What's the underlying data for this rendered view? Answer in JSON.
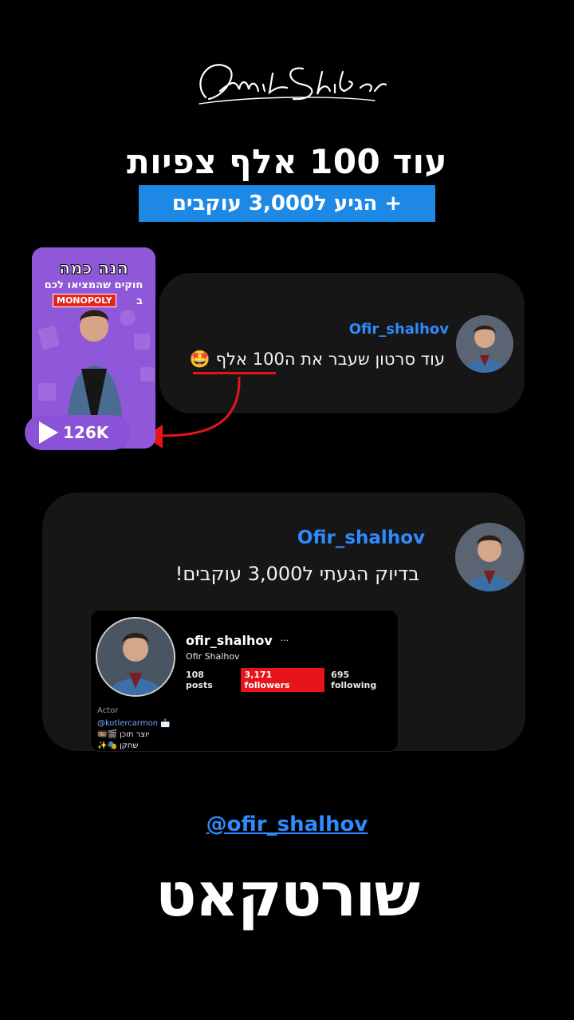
{
  "brand_signature": "Amit Shiber",
  "headline": "עוד 100 אלף צפיות",
  "subheadline": "+ הגיע ל3,000 עוקבים",
  "thumbnail": {
    "title_line1": "הנה כמה",
    "title_line2": "חוקים שהמציאו לכם",
    "title_line3": "ב",
    "monopoly": "MONOPOLY",
    "views": "126K"
  },
  "message1": {
    "username": "Ofir_shalhov",
    "text": "עוד סרטון שעבר את ה100 אלף 🤩"
  },
  "message2": {
    "username": "Ofir_shalhov",
    "text": "בדיוק הגעתי ל3,000 עוקבים!"
  },
  "profile": {
    "handle": "ofir_shalhov",
    "more": "···",
    "name": "Ofir Shalhov",
    "posts": "108 posts",
    "followers": "3,171 followers",
    "following": "695 following",
    "bio_category": "Actor",
    "bio_line1": "@kotlercarmon 📩",
    "bio_line2": "יוצר תוכן 🎬🎞️",
    "bio_line3": "שחקן 🎭✨"
  },
  "threads_handle": "@ofir_shalhov",
  "footer_brand": "שורטקאט",
  "colors": {
    "accent_blue": "#1e88e5",
    "link_blue": "#2e8bff",
    "highlight_red": "#e6141a",
    "card_bg": "#161616",
    "thumbnail_purple": "#8f58d8"
  }
}
